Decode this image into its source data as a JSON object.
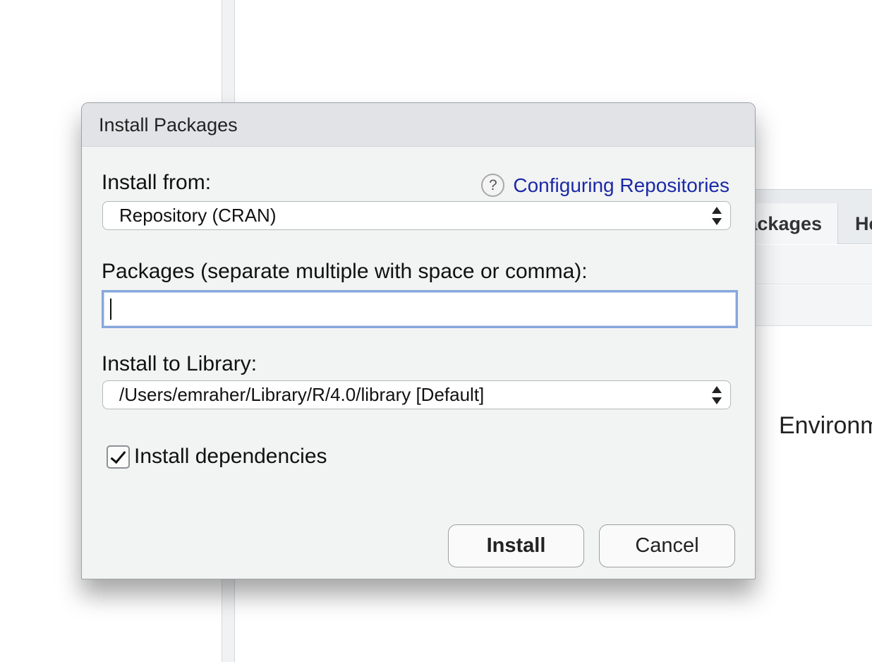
{
  "background": {
    "tabs": [
      {
        "label": "Packages"
      },
      {
        "label": "Help"
      }
    ],
    "environment_text": "Environment is empty"
  },
  "dialog": {
    "title": "Install Packages",
    "install_from_label": "Install from:",
    "help_link_label": "Configuring Repositories",
    "help_icon": "question-mark-icon",
    "install_from_value": "Repository (CRAN)",
    "packages_label": "Packages (separate multiple with space or comma):",
    "packages_value": "",
    "library_label": "Install to Library:",
    "library_value": "/Users/emraher/Library/R/4.0/library [Default]",
    "dependencies_label": "Install dependencies",
    "dependencies_checked": true,
    "install_button": "Install",
    "cancel_button": "Cancel"
  }
}
